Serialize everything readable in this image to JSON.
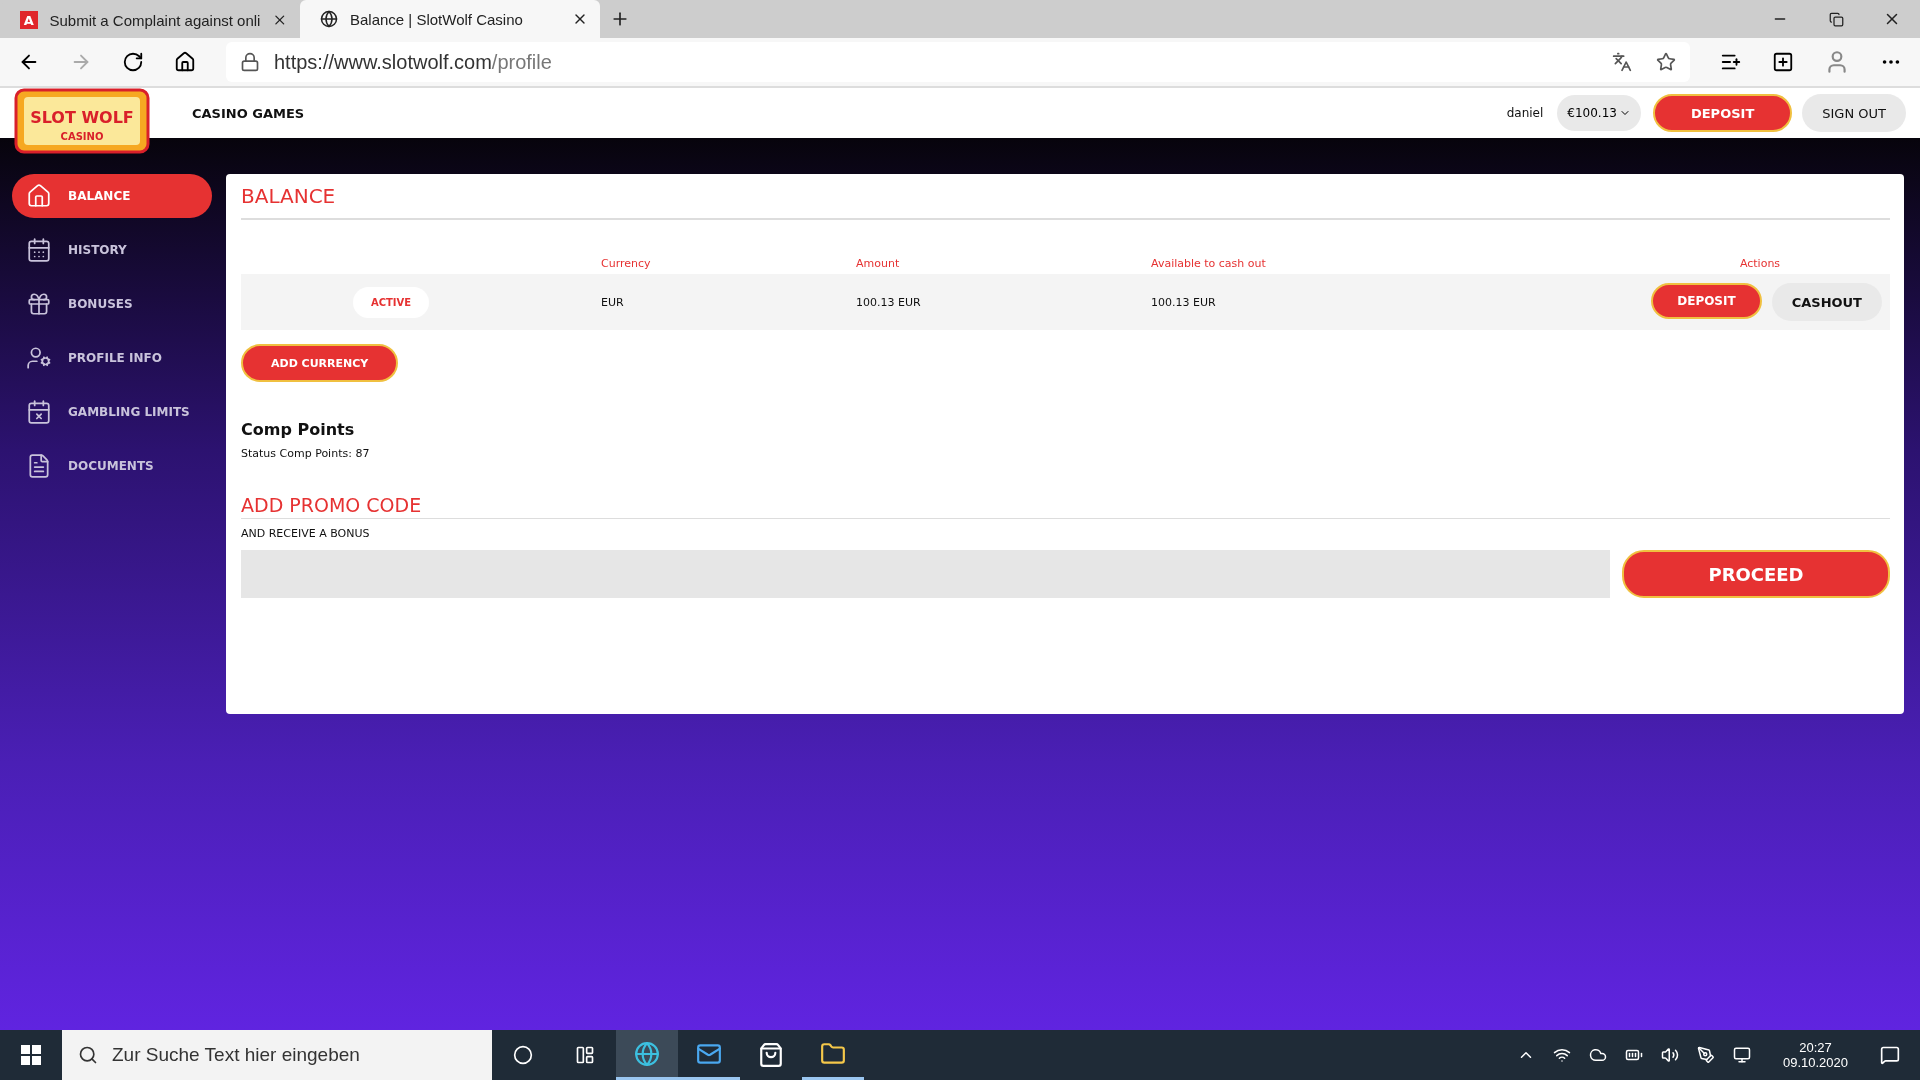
{
  "browser": {
    "tabs": [
      {
        "title": "Submit a Complaint against onli",
        "selected": false,
        "icon": "A"
      },
      {
        "title": "Balance | SlotWolf Casino",
        "selected": true
      }
    ],
    "url": {
      "host": "https://www.slotwolf.com",
      "path": "/profile"
    }
  },
  "header": {
    "logo": {
      "title": "SLOT WOLF",
      "subtitle": "CASINO"
    },
    "nav": [
      "CASINO GAMES"
    ],
    "username": "daniel",
    "balance": "€100.13",
    "deposit": "DEPOSIT",
    "sign_out": "SIGN OUT"
  },
  "sidebar": {
    "items": [
      {
        "label": "BALANCE",
        "kind": "home",
        "selected": true
      },
      {
        "label": "HISTORY",
        "kind": "calendar",
        "selected": false
      },
      {
        "label": "BONUSES",
        "kind": "gift",
        "selected": false
      },
      {
        "label": "PROFILE INFO",
        "kind": "profile",
        "selected": false
      },
      {
        "label": "GAMBLING LIMITS",
        "kind": "limits",
        "selected": false
      },
      {
        "label": "DOCUMENTS",
        "kind": "documents",
        "selected": false
      }
    ]
  },
  "balance": {
    "title": "BALANCE",
    "table": {
      "columns": [
        "Currency",
        "Amount",
        "Available to cash out",
        "Actions"
      ],
      "rows": [
        {
          "status": "ACTIVE",
          "currency": "EUR",
          "amount": "100.13 EUR",
          "available": "100.13 EUR",
          "actions": [
            "DEPOSIT",
            "CASHOUT"
          ]
        }
      ]
    },
    "add_currency": "ADD CURRENCY"
  },
  "comp_points": {
    "title": "Comp Points",
    "status": "Status Comp Points: 87"
  },
  "promo": {
    "title": "ADD PROMO CODE",
    "subtitle": "AND RECEIVE A BONUS",
    "button": "PROCEED"
  },
  "taskbar": {
    "search_placeholder": "Zur Suche Text hier eingeben",
    "time": "20:27",
    "date": "09.10.2020"
  }
}
